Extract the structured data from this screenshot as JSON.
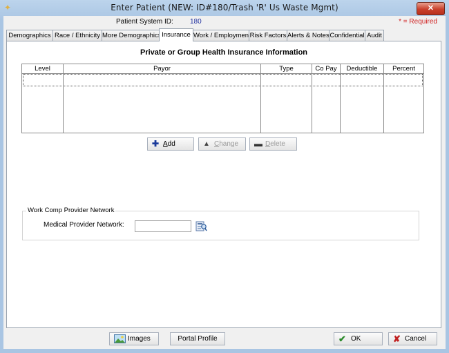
{
  "window": {
    "title": "Enter Patient (NEW: ID#180/Trash 'R' Us Waste Mgmt)",
    "close_glyph": "✕"
  },
  "header": {
    "system_id_label": "Patient System ID:",
    "system_id_value": "180",
    "required_note": "* = Required"
  },
  "tabs": [
    {
      "label": "Demographics",
      "active": false
    },
    {
      "label": "Race / Ethnicity",
      "active": false
    },
    {
      "label": "More Demographics",
      "active": false
    },
    {
      "label": "Insurance",
      "active": true
    },
    {
      "label": "Work / Employment",
      "active": false
    },
    {
      "label": "Risk Factors",
      "active": false
    },
    {
      "label": "Alerts & Notes",
      "active": false
    },
    {
      "label": "Confidential",
      "active": false
    },
    {
      "label": "Audit",
      "active": false
    }
  ],
  "insurance": {
    "section_title": "Private or Group Health Insurance Information",
    "columns": [
      "Level",
      "Payor",
      "Type",
      "Co Pay",
      "Deductible",
      "Percent"
    ],
    "rows": [],
    "buttons": {
      "add": {
        "mnemonic": "A",
        "rest": "dd",
        "enabled": true,
        "icon": "plus-icon"
      },
      "change": {
        "mnemonic": "C",
        "rest": "hange",
        "enabled": false,
        "icon": "triangle-icon"
      },
      "delete": {
        "mnemonic": "D",
        "rest": "elete",
        "enabled": false,
        "icon": "minus-icon"
      }
    }
  },
  "work_comp": {
    "group_label": "Work Comp Provider Network",
    "field_label": "Medical Provider Network:",
    "field_value": "",
    "lookup_icon": "lookup-icon"
  },
  "footer": {
    "images": "Images",
    "portal_profile": "Portal Profile",
    "ok": "OK",
    "cancel": "Cancel"
  },
  "colors": {
    "accent_blue": "#1a3a9a",
    "required_red": "#d02020",
    "ok_green": "#2a8a2a",
    "cancel_red": "#c02020"
  }
}
